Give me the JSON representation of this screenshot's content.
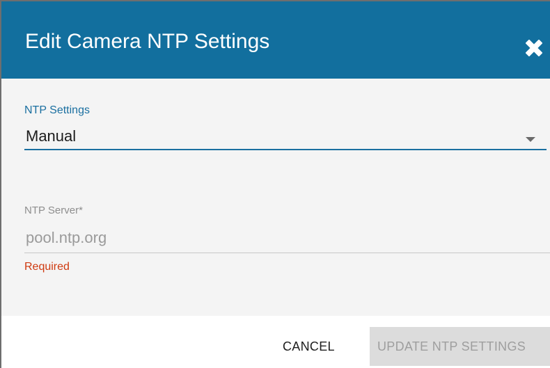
{
  "dialog": {
    "title": "Edit Camera NTP Settings",
    "close_icon": "close-x-icon"
  },
  "ntp_settings": {
    "label": "NTP Settings",
    "selected": "Manual",
    "dropdown_icon": "caret-down-icon"
  },
  "ntp_server": {
    "label": "NTP Server",
    "required_marker": "*",
    "placeholder": "pool.ntp.org",
    "value": "",
    "error": "Required"
  },
  "actions": {
    "cancel_label": "CANCEL",
    "update_label": "UPDATE NTP SETTINGS",
    "update_disabled": true
  },
  "colors": {
    "header_bg": "#126f9e",
    "accent": "#1a6fa0",
    "error": "#cf3a10",
    "body_bg": "#f4f4f4",
    "disabled_bg": "#dcdcdc"
  }
}
